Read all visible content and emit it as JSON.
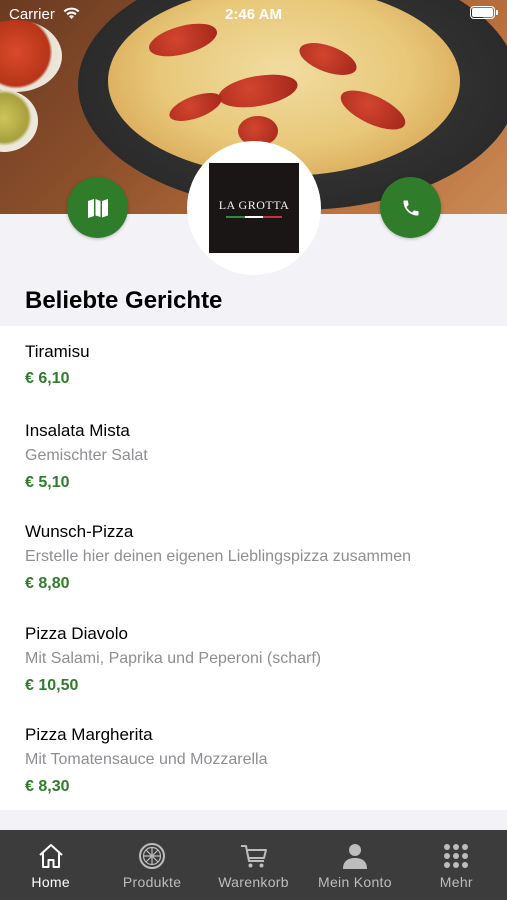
{
  "status_bar": {
    "carrier": "Carrier",
    "time": "2:46 AM"
  },
  "header": {
    "logo_text": "LA GROTTA"
  },
  "section": {
    "title": "Beliebte Gerichte"
  },
  "dishes": [
    {
      "name": "Tiramisu",
      "description": "",
      "price": "€ 6,10"
    },
    {
      "name": "Insalata Mista",
      "description": "Gemischter Salat",
      "price": "€ 5,10"
    },
    {
      "name": "Wunsch-Pizza",
      "description": "Erstelle hier deinen eigenen Lieblingspizza zusammen",
      "price": "€ 8,80"
    },
    {
      "name": "Pizza Diavolo",
      "description": "Mit Salami, Paprika und Peperoni (scharf)",
      "price": "€ 10,50"
    },
    {
      "name": "Pizza Margherita",
      "description": "Mit Tomatensauce und Mozzarella",
      "price": "€ 8,30"
    }
  ],
  "tabs": [
    {
      "label": "Home",
      "icon": "home-icon",
      "active": true
    },
    {
      "label": "Produkte",
      "icon": "pizza-icon",
      "active": false
    },
    {
      "label": "Warenkorb",
      "icon": "cart-icon",
      "active": false
    },
    {
      "label": "Mein Konto",
      "icon": "person-icon",
      "active": false
    },
    {
      "label": "Mehr",
      "icon": "grid-icon",
      "active": false
    }
  ],
  "colors": {
    "accent": "#2f7d2a",
    "tabbar": "#3c3c3c",
    "secondary_text": "#8e8e93"
  }
}
